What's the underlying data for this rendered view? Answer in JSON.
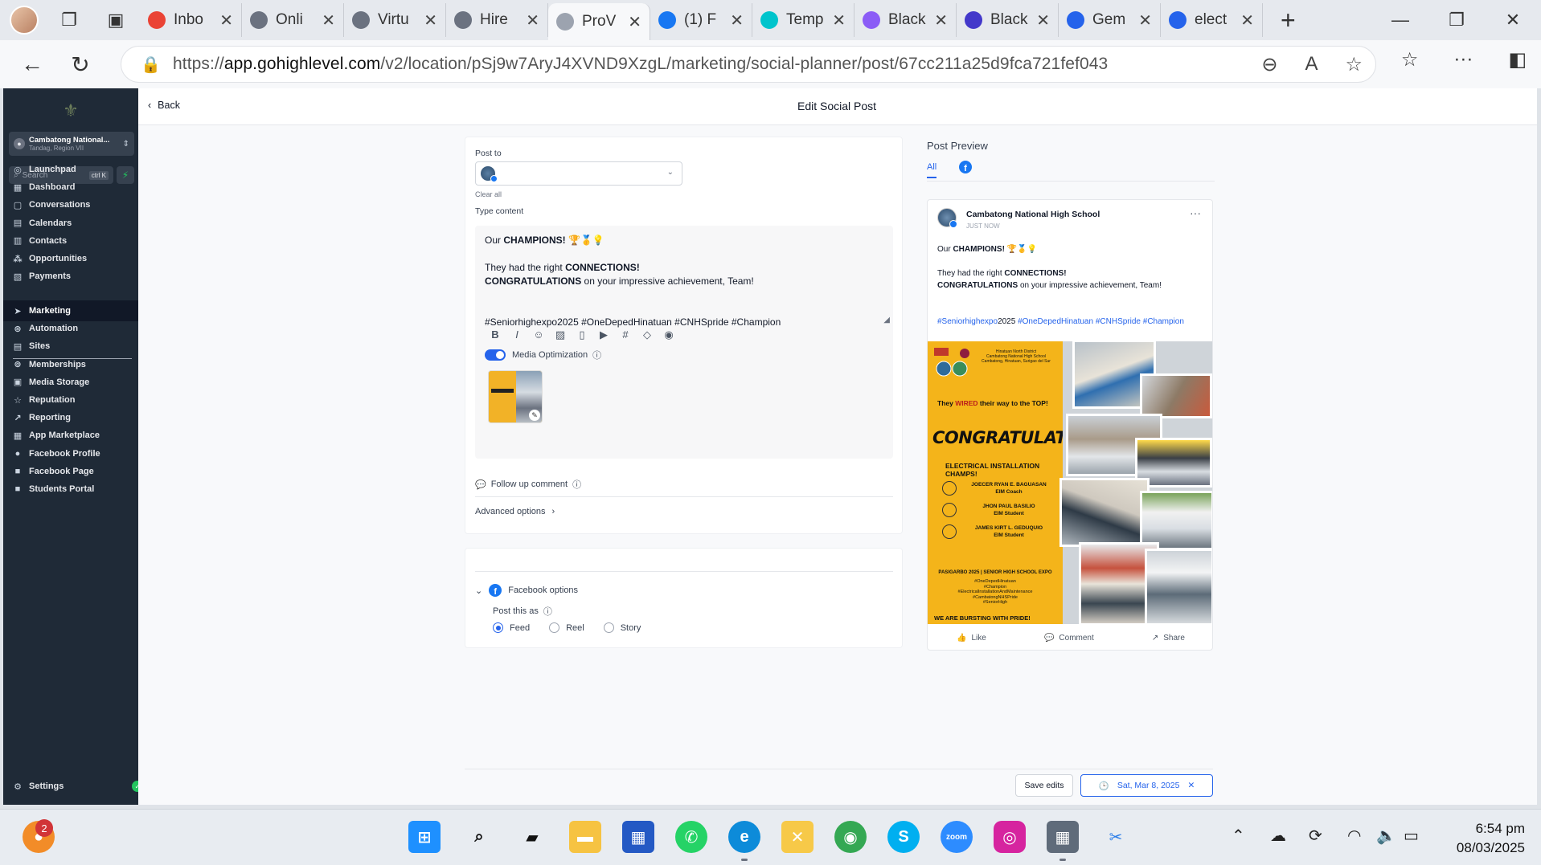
{
  "browser": {
    "tabs": [
      {
        "title": "Inbo",
        "icon": "gmail-icon",
        "color": "#ea4335"
      },
      {
        "title": "Onli",
        "icon": "openai-icon",
        "color": "#6b7280"
      },
      {
        "title": "Virtu",
        "icon": "openai-icon",
        "color": "#6b7280"
      },
      {
        "title": "Hire",
        "icon": "openai-icon",
        "color": "#6b7280"
      },
      {
        "title": "ProV",
        "icon": "highlevel-icon",
        "color": "#9ca3af",
        "active": true
      },
      {
        "title": "(1) F",
        "icon": "facebook-icon",
        "color": "#1877f2"
      },
      {
        "title": "Temp",
        "icon": "canva-icon",
        "color": "#00c4cc"
      },
      {
        "title": "Black",
        "icon": "heart-shield-icon",
        "color": "#8b5cf6"
      },
      {
        "title": "Black",
        "icon": "heart-shield-icon",
        "color": "#4338ca"
      },
      {
        "title": "Gem",
        "icon": "gemini-icon",
        "color": "#2563eb"
      },
      {
        "title": "elect",
        "icon": "search-icon",
        "color": "#2563eb"
      }
    ],
    "url_prefix": "https://",
    "url_host": "app.gohighlevel.com",
    "url_path": "/v2/location/pSj9w7AryJ4XVND9XzgL/marketing/social-planner/post/67cc211a25d9fca721fef043"
  },
  "sidebar": {
    "location_name": "Cambatong National...",
    "location_sub": "Tandag, Region VII",
    "search_placeholder": "Search",
    "search_shortcut": "ctrl K",
    "items_top": [
      {
        "label": "Launchpad",
        "icon": "rocket-icon"
      },
      {
        "label": "Dashboard",
        "icon": "grid-icon"
      },
      {
        "label": "Conversations",
        "icon": "chat-icon"
      },
      {
        "label": "Calendars",
        "icon": "calendar-icon"
      },
      {
        "label": "Contacts",
        "icon": "contacts-icon"
      },
      {
        "label": "Opportunities",
        "icon": "funnel-icon"
      },
      {
        "label": "Payments",
        "icon": "payments-icon"
      }
    ],
    "items_bottom": [
      {
        "label": "Marketing",
        "icon": "send-icon",
        "active": true
      },
      {
        "label": "Automation",
        "icon": "automation-icon"
      },
      {
        "label": "Sites",
        "icon": "sites-icon"
      },
      {
        "label": "Memberships",
        "icon": "memberships-icon"
      },
      {
        "label": "Media Storage",
        "icon": "folder-icon"
      },
      {
        "label": "Reputation",
        "icon": "star-icon"
      },
      {
        "label": "Reporting",
        "icon": "chart-icon"
      },
      {
        "label": "App Marketplace",
        "icon": "apps-icon"
      },
      {
        "label": "Facebook Profile",
        "icon": "user-icon"
      },
      {
        "label": "Facebook Page",
        "icon": "page-icon"
      },
      {
        "label": "Students Portal",
        "icon": "portal-icon"
      }
    ],
    "settings_label": "Settings"
  },
  "header": {
    "back_label": "Back",
    "title": "Edit Social Post"
  },
  "composer": {
    "post_to_label": "Post to",
    "clear_all": "Clear all",
    "type_content_label": "Type content",
    "content_lines": [
      {
        "pre": "Our ",
        "bold": "CHAMPIONS!",
        "post": " 🏆🥇💡"
      },
      {
        "pre": "",
        "bold": "",
        "post": ""
      },
      {
        "pre": "They had the right ",
        "bold": "CONNECTIONS!",
        "post": ""
      },
      {
        "pre": "",
        "bold": "CONGRATULATIONS",
        "post": " on your impressive achievement, Team!"
      },
      {
        "pre": "",
        "bold": "",
        "post": ""
      },
      {
        "pre": "",
        "bold": "",
        "post": ""
      },
      {
        "pre": "#Seniorhighexpo2025 #OneDepedHinatuan #CNHSpride #Champion",
        "bold": "",
        "post": ""
      }
    ],
    "toolbar": [
      "bold-icon",
      "italic-icon",
      "emoji-icon",
      "image-icon",
      "document-icon",
      "video-icon",
      "hashtag-icon",
      "tag-icon",
      "mention-icon"
    ],
    "media_optimization_label": "Media Optimization",
    "media_optimization_on": true,
    "follow_up_label": "Follow up comment",
    "advanced_label": "Advanced options"
  },
  "facebook_options": {
    "label": "Facebook options",
    "post_as_label": "Post this as",
    "options": [
      "Feed",
      "Reel",
      "Story"
    ],
    "selected": "Feed"
  },
  "preview": {
    "title": "Post Preview",
    "tab_all": "All",
    "page_name": "Cambatong National High School",
    "time": "JUST NOW",
    "line1_pre": "Our ",
    "line1_bold": "CHAMPIONS!",
    "line1_post": " 🏆🥇💡",
    "line3_pre": "They had the right ",
    "line3_bold": "CONNECTIONS!",
    "line4_bold": "CONGRATULATIONS",
    "line4_post": " on your impressive achievement, Team!",
    "hashtags": [
      {
        "text": "#Seniorhighexpo",
        "link": true
      },
      {
        "text": "2025",
        "link": false
      },
      {
        "text": " #OneDepedHinatuan",
        "link": true
      },
      {
        "text": " #CNHSpride",
        "link": true
      },
      {
        "text": " #Champion",
        "link": true
      }
    ],
    "poster": {
      "school_line1": "Hinatuan North District",
      "school_line2": "Cambatong National High School",
      "school_line3": "Cambatong, Hinatuan, Surigao del Sur",
      "wired_pre": "They ",
      "wired_bold": "WIRED",
      "wired_mid": " their way to the ",
      "wired_bold2": "TOP!",
      "congrats": "CONGRATULATIONS,",
      "champs": "ELECTRICAL INSTALLATION CHAMPS!",
      "people": [
        {
          "name": "JOECER RYAN E. BAGUASAN",
          "role": "EIM Coach"
        },
        {
          "name": "JHON PAUL BASILIO",
          "role": "EIM Student"
        },
        {
          "name": "JAMES KIRT L. GEDUQUIO",
          "role": "EIM Student"
        }
      ],
      "expo": "PASIGARBO 2025 | SENIOR HIGH SCHOOL EXPO",
      "tags": [
        "#OneDepedHinatuan",
        "#Champion",
        "#ElectricalInstallationAndMaintenance",
        "#CambatongNHSPride",
        "#SeniorHigh"
      ],
      "burst": "WE ARE BURSTING WITH PRIDE!"
    },
    "actions": [
      "Like",
      "Comment",
      "Share"
    ]
  },
  "footer": {
    "save_label": "Save edits",
    "date_label": "Sat, Mar 8, 2025"
  },
  "taskbar": {
    "notification_count": "2",
    "time": "6:54 pm",
    "date": "08/03/2025"
  },
  "colors": {
    "sidebar_bg": "#1f2a37",
    "accent": "#2563eb",
    "facebook": "#1877f2",
    "poster_yellow": "#f4b41a"
  }
}
